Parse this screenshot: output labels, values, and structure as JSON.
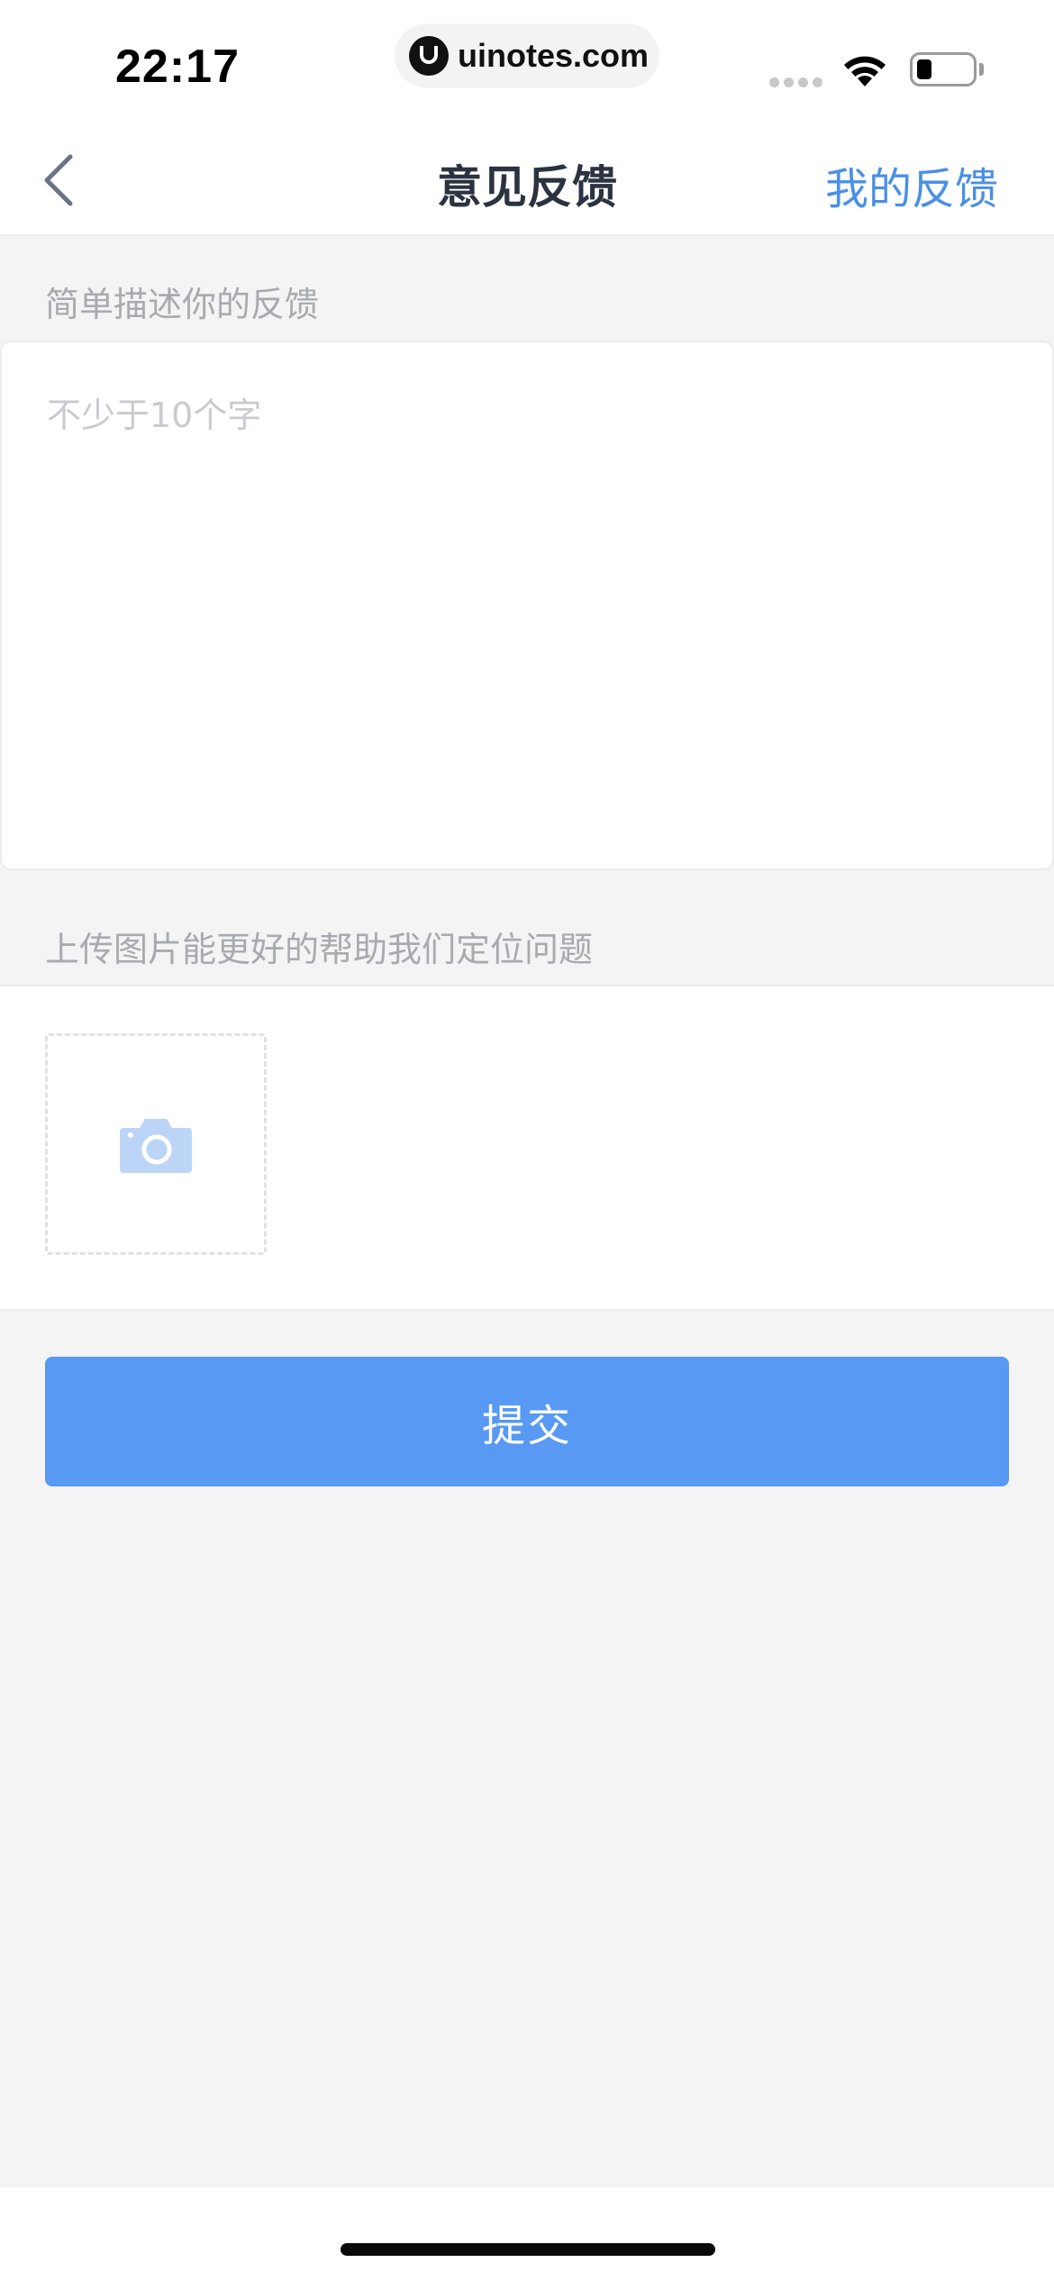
{
  "status_bar": {
    "time": "22:17",
    "url": "uinotes.com"
  },
  "nav": {
    "title": "意见反馈",
    "right_link": "我的反馈"
  },
  "feedback": {
    "label": "简单描述你的反馈",
    "placeholder": "不少于10个字",
    "value": ""
  },
  "upload": {
    "label": "上传图片能更好的帮助我们定位问题"
  },
  "submit": {
    "label": "提交"
  },
  "colors": {
    "accent": "#5799f3",
    "link": "#4a8fe6",
    "camera_icon": "#bcd5f7",
    "background": "#f4f4f5"
  },
  "icons": {
    "back": "chevron-left-icon",
    "upload": "camera-icon",
    "wifi": "wifi-icon",
    "battery": "battery-icon"
  }
}
